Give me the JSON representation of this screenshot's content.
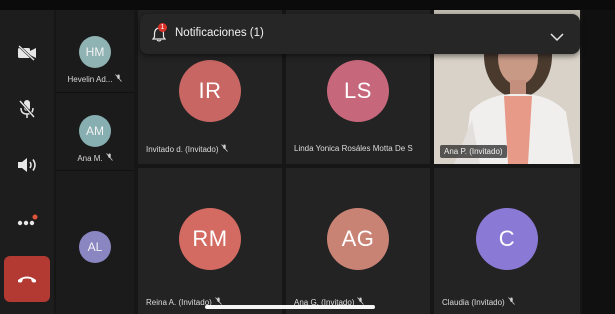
{
  "notification": {
    "label": "Notificaciones (1)",
    "badge": "1"
  },
  "controls": {
    "camera": "camera-off",
    "mic": "mic-off",
    "speaker": "speaker-on",
    "more": "more-options",
    "end": "end-call"
  },
  "sidebar": {
    "participants": [
      {
        "initials": "HM",
        "name": "Hevelin Ad...",
        "color": "#8fb2b2"
      },
      {
        "initials": "AM",
        "name": "Ana M.",
        "color": "#87aeb1"
      },
      {
        "initials": "AL",
        "name": "",
        "color": "#8a86c2"
      }
    ]
  },
  "grid": {
    "tiles": [
      {
        "initials": "IR",
        "name": "Invitado d. (Invitado)",
        "color": "#c76663"
      },
      {
        "initials": "LS",
        "name": "Linda Yonica Rosáles Motta De S",
        "color": "#c7677c"
      },
      {
        "initials": "RM",
        "name": "Reina A. (Invitado)",
        "color": "#d36b62"
      },
      {
        "initials": "AG",
        "name": "Ana G. (Invitado)",
        "color": "#c98375"
      },
      {
        "initials": "C",
        "name": "Claudia (Invitado)",
        "color": "#8b79d6"
      }
    ],
    "video": {
      "name": "Ana P. (Invitado)"
    }
  },
  "colors": {
    "end_call": "#b23a32",
    "badge": "#d9342b"
  }
}
